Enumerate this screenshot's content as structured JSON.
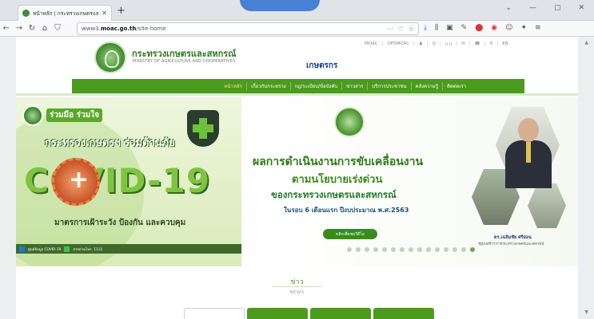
{
  "browser": {
    "tab_title": "หน้าหลัก | กระทรวงเกษตรและสหกรณ์",
    "new_tab": "+",
    "url_prefix": "www3.",
    "url_domain": "moac.go.th",
    "url_path": "/site-home",
    "url_menu": "···",
    "window_controls": [
      "⌄",
      "—",
      "▢",
      "✕"
    ]
  },
  "header": {
    "ministry_th": "กระทรวงเกษตรและสหกรณ์",
    "ministry_en": "MINISTRY OF AGRICULTURE AND COOPERATIVES",
    "kaset_brand": "เกษตรกร",
    "top_links": [
      "MOAC",
      "OPSMOAC",
      "♟",
      "Q",
      "ก ก",
      "✉",
      "☎",
      "⚲",
      "EN"
    ]
  },
  "menu": {
    "items": [
      "หน้าหลัก",
      "เกี่ยวกับกระทรวง",
      "กฎ/ระเบียบ/ข้อบังคับ",
      "ข่าวสาร",
      "บริการประชาชน",
      "คลังความรู้",
      "ติดต่อเรา"
    ]
  },
  "covid_banner": {
    "together": "ร่วมมือ ร่วมใจ",
    "ministry_fight": "กระทรวงเกษตรฯ ร่วมต้านภัย",
    "title": "COVID-19",
    "subtitle": "มาตรการเฝ้าระวัง ป้องกัน และควบคุม",
    "footer_center": "ศูนย์ข้อมูล COVID-19",
    "footer_line": "สายด่วนโทร. 1111"
  },
  "hero": {
    "line1": "ผลการดำเนินงานการขับเคลื่อนงาน",
    "line2": "ตามนโยบายเร่งด่วน",
    "line3": "ของกระทรวงเกษตรและสหกรณ์",
    "line4": "ในรอบ 6 เดือนแรก ปีงบประมาณ พ.ศ.2563",
    "button": "คลิกเพื่อชมวีดีโอ",
    "photo_name": "ดร.เฉลิมชัย ศรีอ่อน",
    "photo_role": "รัฐมนตรีว่าการกระทรวงเกษตรและสหกรณ์"
  },
  "news": {
    "title": "ข่าว",
    "subtitle": "NEWS"
  },
  "colors": {
    "primary_green": "#4b9b1f",
    "header_green": "#2d7a1f",
    "brand_blue": "#1f3b8f"
  }
}
